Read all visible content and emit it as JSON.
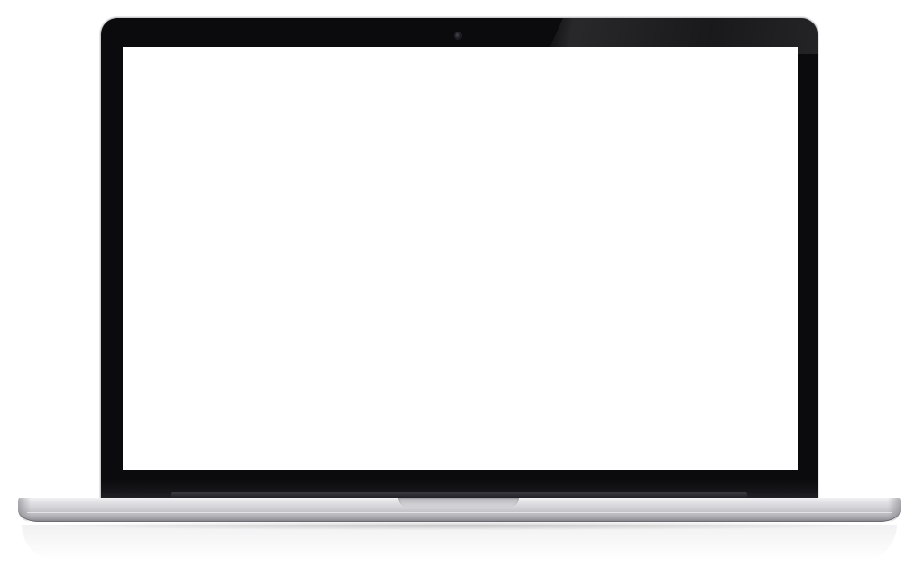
{
  "device": {
    "kind": "laptop-mockup",
    "screen_state": "blank",
    "colors": {
      "bezel": "#0b0b0d",
      "screen": "#ffffff",
      "body": "#cfcfd3",
      "background": "#ffffff"
    }
  }
}
